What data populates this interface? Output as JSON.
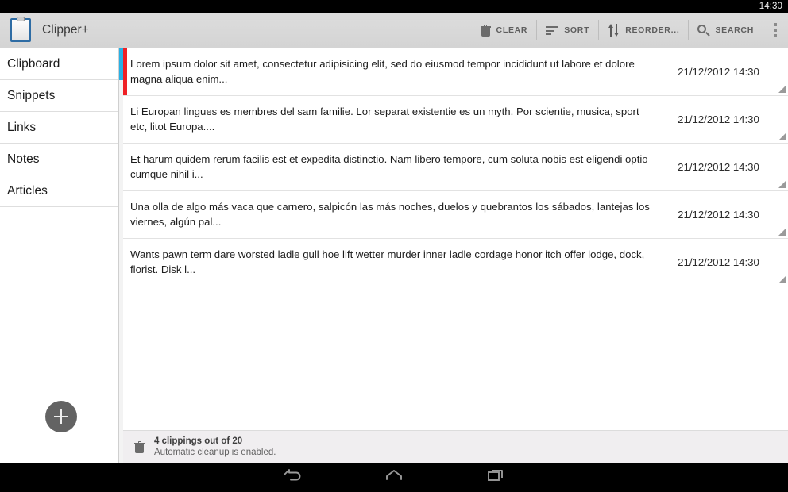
{
  "system": {
    "status_bar": {
      "clock": "14:30"
    },
    "nav_bar": {
      "back_label": "Back",
      "home_label": "Home",
      "recents_label": "Recent apps"
    }
  },
  "app": {
    "title": "Clipper+",
    "icon": "clipboard-icon"
  },
  "actionbar": {
    "actions": [
      {
        "label": "CLEAR",
        "icon": "trash-icon"
      },
      {
        "label": "SORT",
        "icon": "sort-icon"
      },
      {
        "label": "REORDER...",
        "icon": "reorder-icon"
      },
      {
        "label": "SEARCH",
        "icon": "search-icon"
      }
    ],
    "overflow": {
      "icon": "overflow-menu-icon",
      "label": "More options"
    }
  },
  "sidebar": {
    "items": [
      {
        "label": "Clipboard",
        "selected": true
      },
      {
        "label": "Snippets",
        "selected": false
      },
      {
        "label": "Links",
        "selected": false
      },
      {
        "label": "Notes",
        "selected": false
      },
      {
        "label": "Articles",
        "selected": false
      }
    ],
    "fab": {
      "icon": "plus-icon",
      "label": "Add clipping"
    }
  },
  "colors": {
    "selection_indicator": "#29b0e5",
    "item_accent": "#ef2025",
    "actionbar_bg": "#d8d8d8",
    "status_strip_bg": "#f0eef0"
  },
  "clippings": [
    {
      "text": "Lorem ipsum dolor sit amet, consectetur adipisicing elit, sed do eiusmod tempor incididunt ut labore et dolore magna aliqua enim...",
      "timestamp": "21/12/2012 14:30",
      "accent": true
    },
    {
      "text": "Li Europan lingues es membres del sam familie. Lor separat existentie es un myth. Por scientie, musica, sport etc, litot Europa....",
      "timestamp": "21/12/2012 14:30",
      "accent": false
    },
    {
      "text": "Et harum quidem rerum facilis est et expedita distinctio. Nam libero tempore, cum soluta nobis est eligendi optio cumque nihil i...",
      "timestamp": "21/12/2012 14:30",
      "accent": false
    },
    {
      "text": "Una olla de algo más vaca que carnero, salpicón las más noches, duelos y quebrantos los sábados, lantejas los viernes, algún pal...",
      "timestamp": "21/12/2012 14:30",
      "accent": false
    },
    {
      "text": "Wants pawn term dare worsted ladle gull hoe lift wetter murder inner ladle cordage honor itch offer lodge, dock, florist. Disk l...",
      "timestamp": "21/12/2012 14:30",
      "accent": false
    }
  ],
  "status_strip": {
    "icon": "trash-icon",
    "primary": "4 clippings out of 20",
    "secondary": "Automatic cleanup is enabled."
  }
}
